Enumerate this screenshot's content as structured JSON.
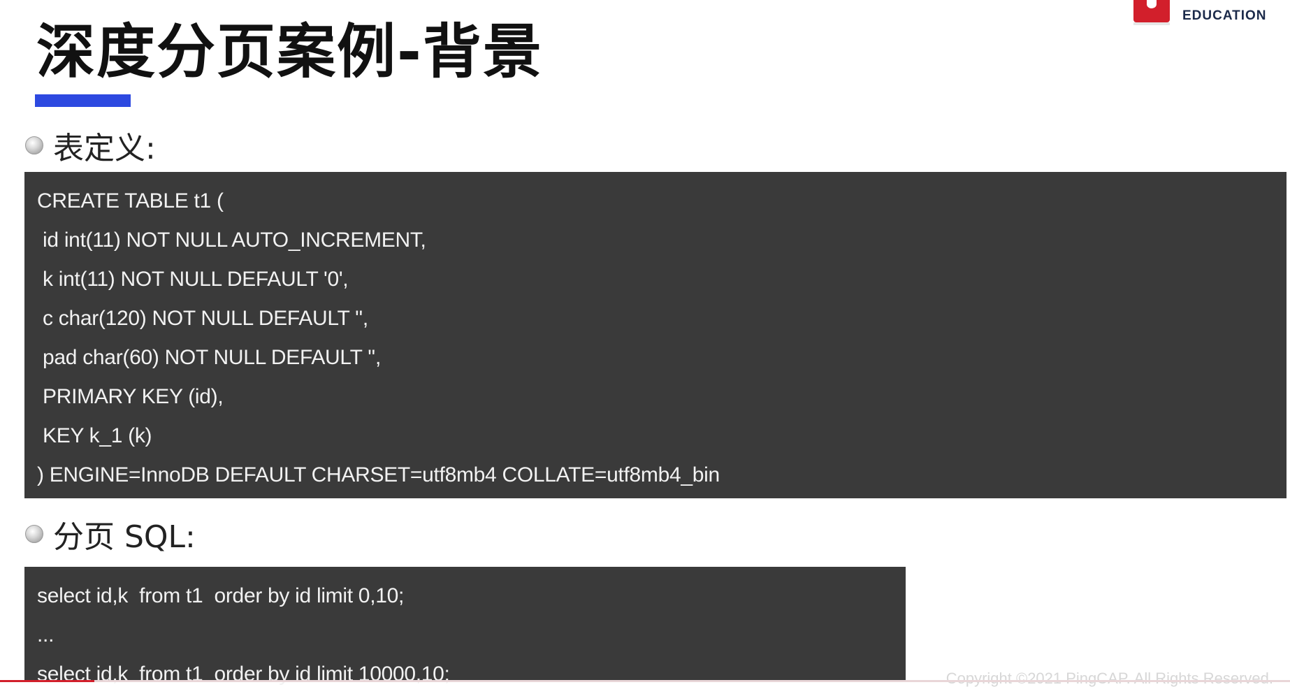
{
  "slide": {
    "title": "深度分页案例-背景",
    "logo_text": "EDUCATION"
  },
  "sections": {
    "table_def": {
      "label": "表定义:",
      "lines": [
        "CREATE TABLE t1 (",
        " id int(11) NOT NULL AUTO_INCREMENT,",
        " k int(11) NOT NULL DEFAULT '0',",
        " c char(120) NOT NULL DEFAULT '',",
        " pad char(60) NOT NULL DEFAULT '',",
        " PRIMARY KEY (id),",
        " KEY k_1 (k)",
        ") ENGINE=InnoDB DEFAULT CHARSET=utf8mb4 COLLATE=utf8mb4_bin"
      ]
    },
    "paging_sql": {
      "label": "分页 SQL:",
      "lines": [
        "select id,k  from t1  order by id limit 0,10;",
        "...",
        "select id,k  from t1  order by id limit 10000,10;"
      ]
    }
  },
  "footer": {
    "copyright": "Copyright ©2021 PingCAP. All Rights Reserved."
  },
  "playback": {
    "progress": 0.073
  }
}
